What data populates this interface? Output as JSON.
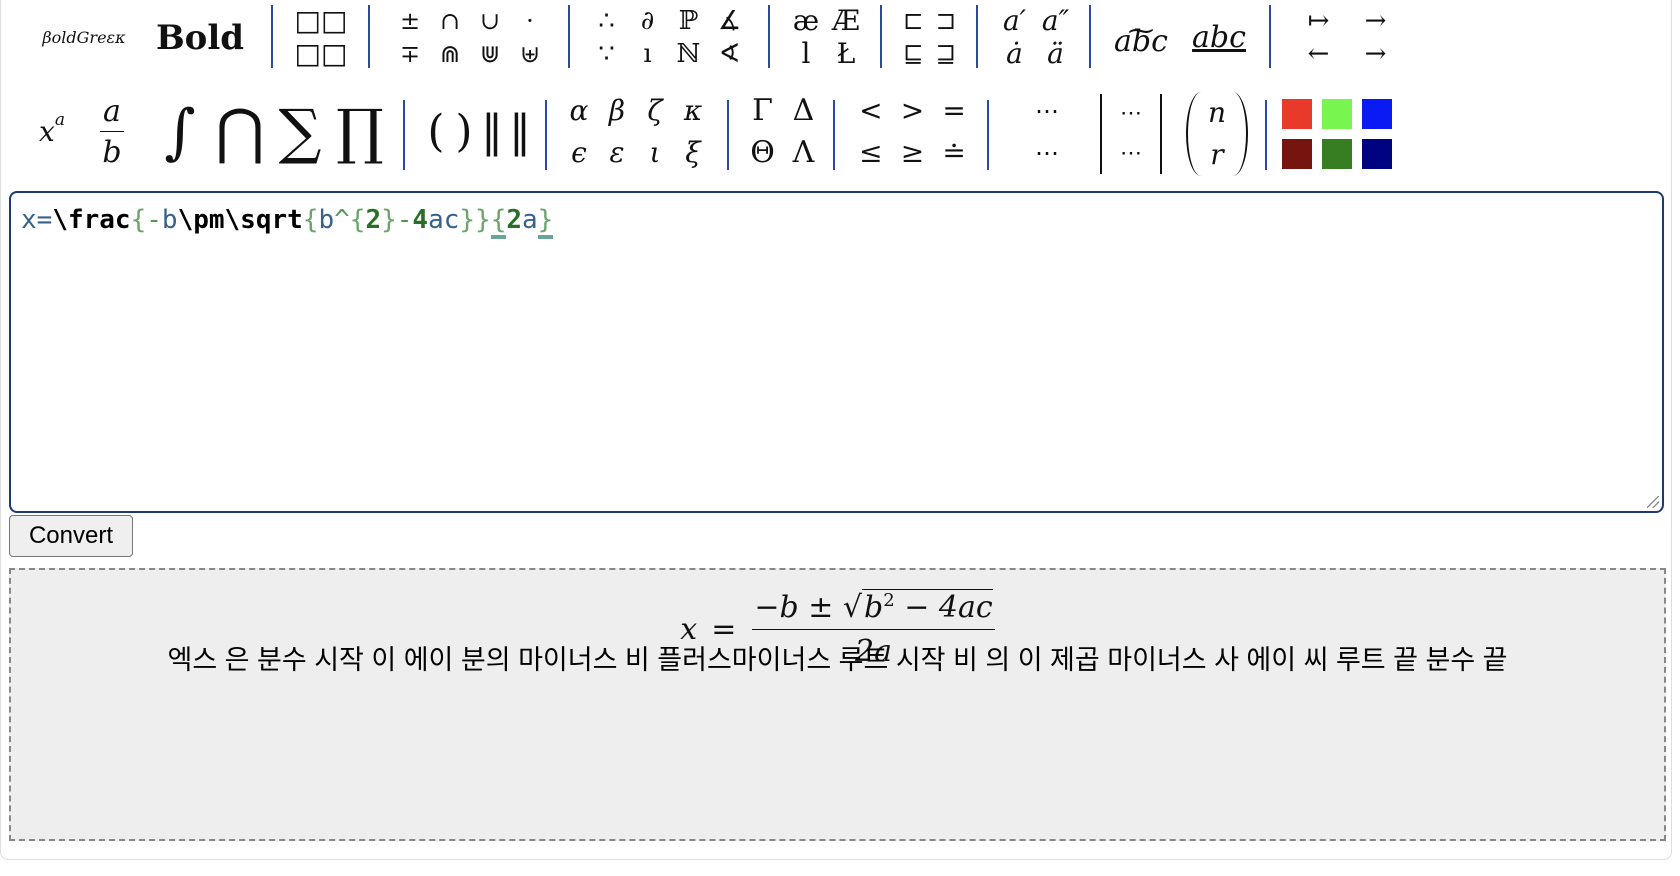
{
  "toolbar": {
    "style_buttons": [
      "βoldGreεκ",
      "Bold"
    ],
    "box_layouts": [
      "□□",
      "□□"
    ],
    "operators": [
      "±",
      "∩",
      "∪",
      "·",
      "∓",
      "⋒",
      "⋓",
      "⊎"
    ],
    "misc_symbols": [
      "∴",
      "∂",
      "ℙ",
      "∡",
      "∵",
      "ı",
      "ℕ",
      "∢"
    ],
    "letters": [
      "æ",
      "Æ",
      "l",
      "Ł"
    ],
    "subsets": [
      "⊏",
      "⊐",
      "⊑",
      "⊒"
    ],
    "accents": [
      "a′",
      "a″",
      "ȧ",
      "ä"
    ],
    "decorations": [
      "abc",
      "abc"
    ],
    "arrows": [
      "↦",
      "→",
      "←",
      "→"
    ],
    "superscript": {
      "base": "x",
      "exp": "a"
    },
    "fraction": {
      "num": "a",
      "den": "b"
    },
    "big_operators": [
      "∫",
      "⋂",
      "∑",
      "∏"
    ],
    "delimiters": [
      "(",
      ")",
      "‖",
      "‖"
    ],
    "greek_lower": [
      "α",
      "β",
      "ζ",
      "κ",
      "ϵ",
      "ε",
      "ι",
      "ξ"
    ],
    "greek_upper": [
      "Γ",
      "Δ",
      "Θ",
      "Λ"
    ],
    "relations": [
      "<",
      ">",
      "=",
      "≤",
      "≥",
      "≐"
    ],
    "dots": [
      "⋯",
      "⋯"
    ],
    "matrix": [
      "⋯",
      "⋯"
    ],
    "binomial": [
      "n",
      "r"
    ],
    "colors": [
      "#e8392a",
      "#78f54e",
      "#0a1af5",
      "#761410",
      "#377e22",
      "#00037f"
    ]
  },
  "editor": {
    "tokens": [
      {
        "t": "x",
        "k": "var"
      },
      {
        "t": "=",
        "k": "var"
      },
      {
        "t": "\\frac",
        "k": "cmd"
      },
      {
        "t": "{",
        "k": "brace"
      },
      {
        "t": "-",
        "k": "op"
      },
      {
        "t": "b",
        "k": "var"
      },
      {
        "t": "\\pm",
        "k": "cmd"
      },
      {
        "t": "\\sqrt",
        "k": "cmd"
      },
      {
        "t": "{",
        "k": "brace"
      },
      {
        "t": "b",
        "k": "var"
      },
      {
        "t": "^",
        "k": "op"
      },
      {
        "t": "{",
        "k": "brace"
      },
      {
        "t": "2",
        "k": "num"
      },
      {
        "t": "}",
        "k": "brace"
      },
      {
        "t": "-",
        "k": "op"
      },
      {
        "t": "4",
        "k": "num"
      },
      {
        "t": "ac",
        "k": "var"
      },
      {
        "t": "}",
        "k": "brace"
      },
      {
        "t": "}",
        "k": "brace"
      },
      {
        "t": "{",
        "k": "brace-match"
      },
      {
        "t": "2",
        "k": "num"
      },
      {
        "t": "a",
        "k": "var"
      },
      {
        "t": "}",
        "k": "brace-match"
      }
    ]
  },
  "convert_label": "Convert",
  "output": {
    "formula": {
      "lhs": "x",
      "eq": "=",
      "num_prefix": "−b ±",
      "radical": "√",
      "sqrt_base": "b",
      "sqrt_exp": "2",
      "sqrt_rest": " − 4ac",
      "den": "2a"
    },
    "speech": "엑스 은 분수 시작 이 에이 분의 마이너스 비 플러스마이너스 루트 시작 비 의 이 제곱 마이너스 사 에이 씨 루트 끝 분수 끝"
  }
}
